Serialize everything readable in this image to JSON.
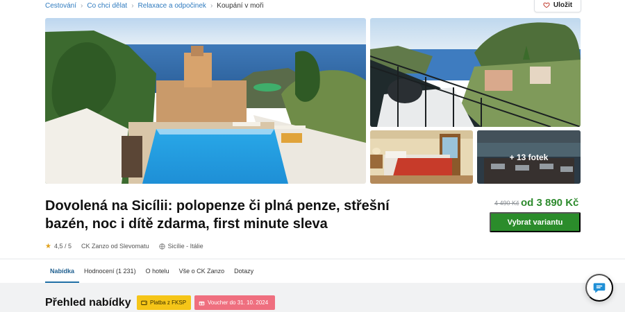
{
  "breadcrumb": [
    {
      "label": "Cestování"
    },
    {
      "label": "Co chci dělat"
    },
    {
      "label": "Relaxace a odpočinek"
    },
    {
      "label": "Koupání v moři"
    }
  ],
  "save_label": "Uložit",
  "gallery": {
    "more_photos_label": "+ 13 fotek"
  },
  "offer": {
    "title": "Dovolená na Sicílii: polopenze či plná penze, střešní bazén, noc i dítě zdarma, first minute sleva",
    "old_price": "4 490 Kč",
    "new_price": "od 3 890 Kč",
    "cta_label": "Vybrat variantu",
    "rating": "4,5 / 5",
    "provider": "CK Zanzo od Slevomatu",
    "location": "Sicílie - Itálie"
  },
  "tabs": [
    {
      "label": "Nabídka",
      "active": true
    },
    {
      "label": "Hodnocení (1 231)"
    },
    {
      "label": "O hotelu"
    },
    {
      "label": "Vše o CK Zanzo"
    },
    {
      "label": "Dotazy"
    }
  ],
  "overview": {
    "title": "Přehled nabídky",
    "badge_fksp": "Platba z FKSP",
    "badge_voucher": "Voucher do 31. 10. 2024"
  },
  "colors": {
    "accent_green": "#2b8c2b",
    "link_blue": "#2f7bbf",
    "badge_yellow": "#f5c518",
    "badge_pink": "#ef6f7f"
  },
  "icons": {
    "save": "heart-icon",
    "rating": "star-icon",
    "location": "globe-icon",
    "chat": "chat-bubble-icon"
  }
}
